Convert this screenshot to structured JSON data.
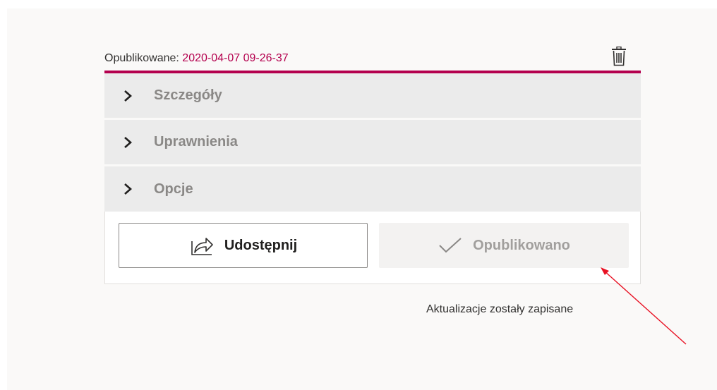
{
  "header": {
    "published_label": "Opublikowane: ",
    "published_date": "2020-04-07 09-26-37",
    "delete_icon": "trash-icon"
  },
  "accordion": {
    "items": [
      {
        "label": "Szczegóły",
        "icon": "chevron-right-icon"
      },
      {
        "label": "Uprawnienia",
        "icon": "chevron-right-icon"
      },
      {
        "label": "Opcje",
        "icon": "chevron-right-icon"
      }
    ]
  },
  "actions": {
    "share_label": "Udostępnij",
    "share_icon": "share-icon",
    "published_label": "Opublikowano",
    "published_icon": "checkmark-icon"
  },
  "status": {
    "message": "Aktualizacje zostały zapisane"
  },
  "colors": {
    "accent": "#b4004e",
    "annotation_arrow": "#e81123"
  }
}
